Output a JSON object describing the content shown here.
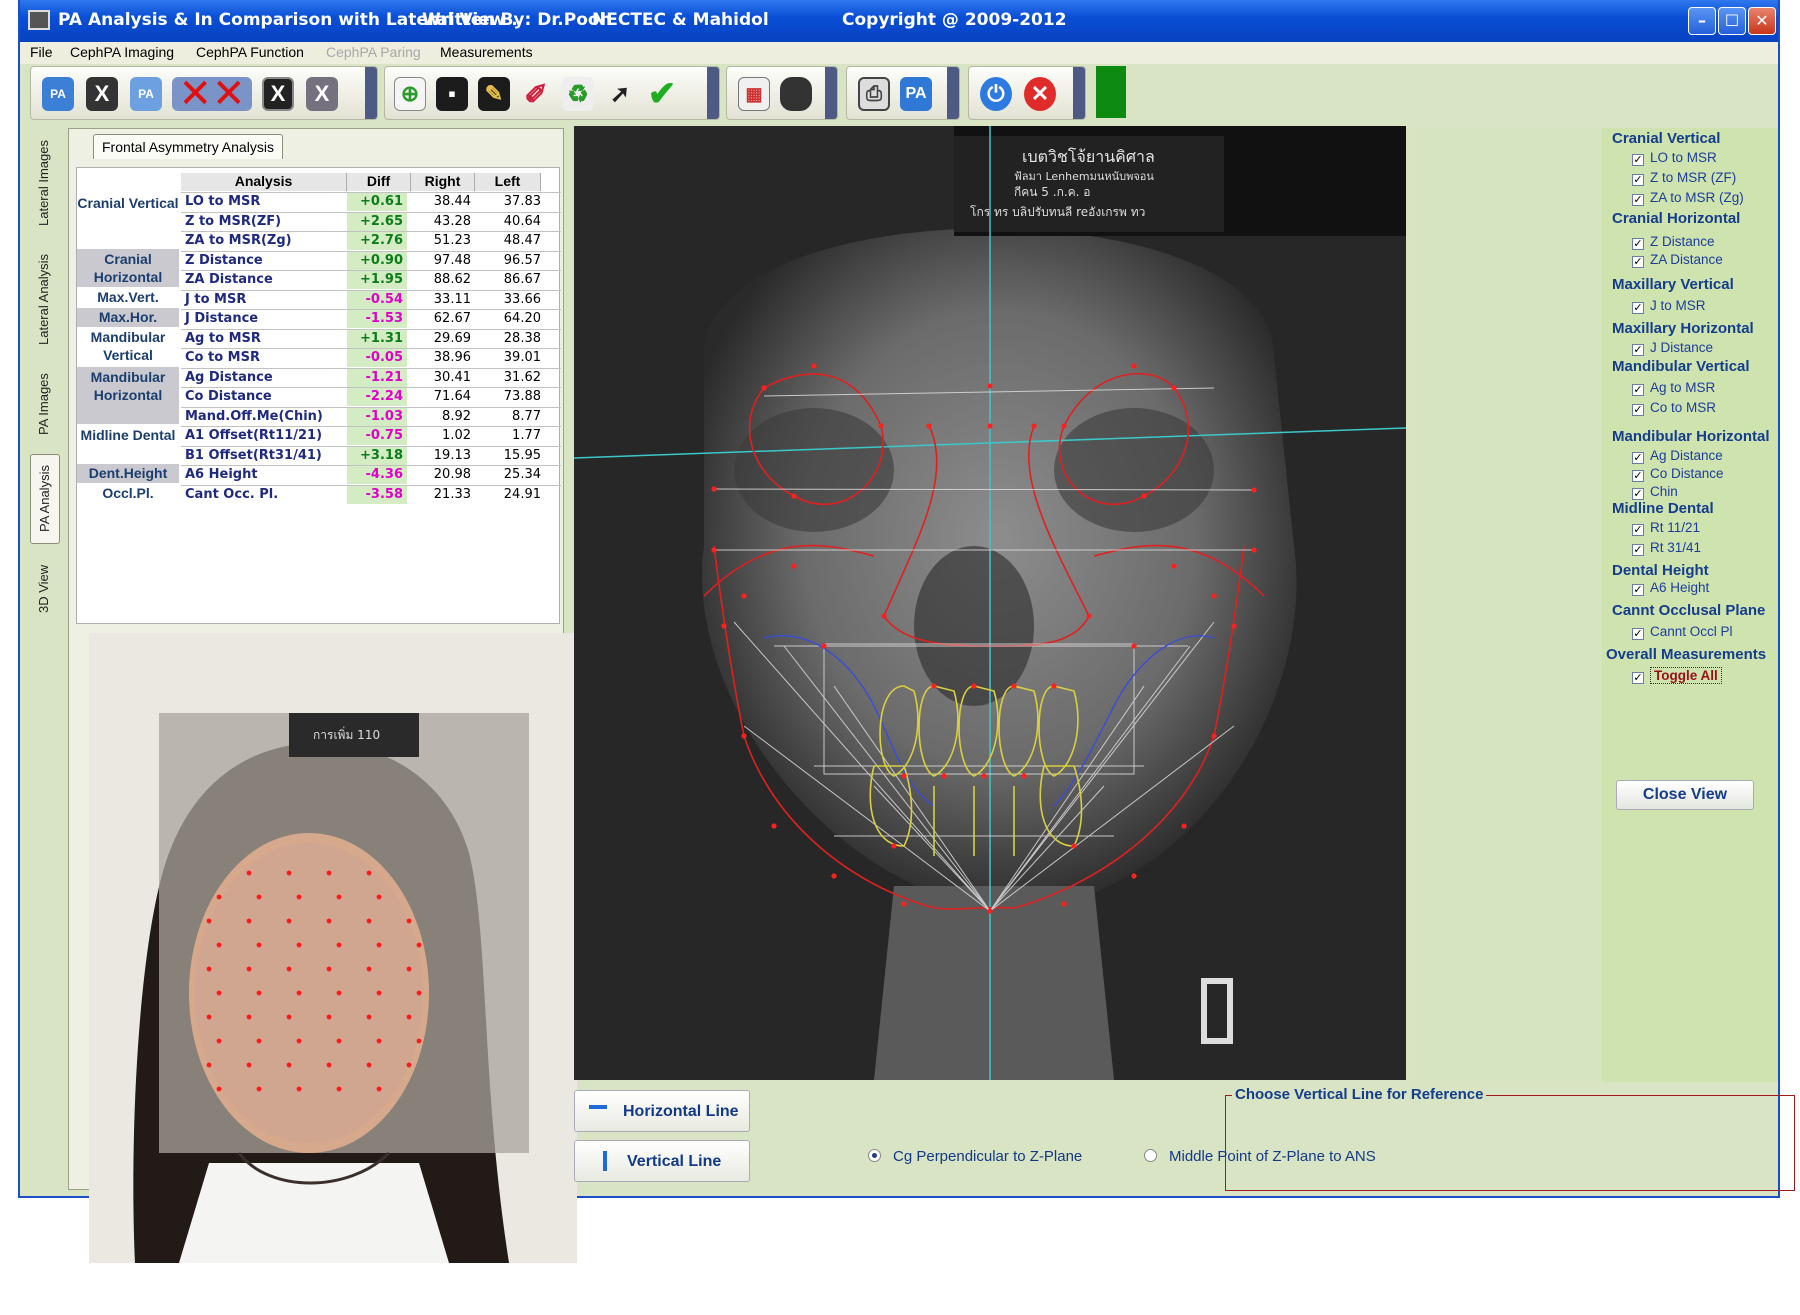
{
  "window": {
    "title": "PA Analysis & In Comparison with Lateral View .",
    "author": "Written By: Dr.Pooh",
    "org": "NECTEC & Mahidol",
    "copyright": "Copyright @ 2009-2012",
    "buttons": {
      "minimize": "–",
      "maximize": "☐",
      "close": "✕"
    }
  },
  "menu": {
    "file": "File",
    "imaging": "CephPA Imaging",
    "function": "CephPA Function",
    "paring": "CephPA Paring",
    "measurements": "Measurements"
  },
  "toolbar": {
    "pa1": "PA",
    "xray": "X",
    "pa2": "PA",
    "x_dark": "X",
    "x_grey": "X",
    "pa_monitor": "PA"
  },
  "side_tabs": [
    "Lateral Images",
    "Lateral Analysis",
    "PA Images",
    "PA Analysis",
    "3D View"
  ],
  "analysis": {
    "tab_label": "Frontal Asymmetry Analysis",
    "headers": {
      "analysis": "Analysis",
      "diff": "Diff",
      "right": "Right",
      "left": "Left"
    },
    "categories": [
      "Cranial Vertical",
      "Cranial Horizontal",
      "Max.Vert.",
      "Max.Hor.",
      "Mandibular Vertical",
      "Mandibular Horizontal",
      "Midline Dental",
      "Dent.Height",
      "Occl.Pl."
    ],
    "rows": [
      {
        "name": "LO to MSR",
        "diff": "+0.61",
        "right": "38.44",
        "left": "37.83"
      },
      {
        "name": "Z to MSR(ZF)",
        "diff": "+2.65",
        "right": "43.28",
        "left": "40.64"
      },
      {
        "name": "ZA to MSR(Zg)",
        "diff": "+2.76",
        "right": "51.23",
        "left": "48.47"
      },
      {
        "name": "Z Distance",
        "diff": "+0.90",
        "right": "97.48",
        "left": "96.57"
      },
      {
        "name": "ZA Distance",
        "diff": "+1.95",
        "right": "88.62",
        "left": "86.67"
      },
      {
        "name": "J to MSR",
        "diff": "-0.54",
        "right": "33.11",
        "left": "33.66"
      },
      {
        "name": "J Distance",
        "diff": "-1.53",
        "right": "62.67",
        "left": "64.20"
      },
      {
        "name": "Ag to MSR",
        "diff": "+1.31",
        "right": "29.69",
        "left": "28.38"
      },
      {
        "name": "Co to MSR",
        "diff": "-0.05",
        "right": "38.96",
        "left": "39.01"
      },
      {
        "name": "Ag Distance",
        "diff": "-1.21",
        "right": "30.41",
        "left": "31.62"
      },
      {
        "name": "Co Distance",
        "diff": "-2.24",
        "right": "71.64",
        "left": "73.88"
      },
      {
        "name": "Mand.Off.Me(Chin)",
        "diff": "-1.03",
        "right": "8.92",
        "left": "8.77"
      },
      {
        "name": "A1 Offset(Rt11/21)",
        "diff": "-0.75",
        "right": "1.02",
        "left": "1.77"
      },
      {
        "name": "B1 Offset(Rt31/41)",
        "diff": "+3.18",
        "right": "19.13",
        "left": "15.95"
      },
      {
        "name": "A6 Height",
        "diff": "-4.36",
        "right": "20.98",
        "left": "25.34"
      },
      {
        "name": "Cant Occ. Pl.",
        "diff": "-3.58",
        "right": "21.33",
        "left": "24.91"
      }
    ]
  },
  "xray_label": {
    "line1": "เบตวิชโจ้ยานคิศาล",
    "line2": "ฟ้ลมา Lenhemมนหนับพจอน",
    "line3": "กีคน 5 .ก.ค. อ",
    "line4": "โกร ทร บลิปรับทนลี reอังเกรพ ทว"
  },
  "photo_label": "การเพิ่ม 110",
  "measurements": {
    "groups": [
      {
        "title": "Cranial Vertical",
        "items": [
          "LO to MSR",
          "Z to MSR (ZF)",
          "ZA to MSR (Zg)"
        ]
      },
      {
        "title": "Cranial Horizontal",
        "items": [
          "Z Distance",
          "ZA Distance"
        ]
      },
      {
        "title": "Maxillary Vertical",
        "items": [
          "J to MSR"
        ]
      },
      {
        "title": "Maxillary Horizontal",
        "items": [
          "J Distance"
        ]
      },
      {
        "title": "Mandibular Vertical",
        "items": [
          "Ag to MSR",
          "Co to MSR"
        ]
      },
      {
        "title": "Mandibular Horizontal",
        "items": [
          "Ag Distance",
          "Co Distance",
          "Chin"
        ]
      },
      {
        "title": "Midline Dental",
        "items": [
          "Rt 11/21",
          "Rt 31/41"
        ]
      },
      {
        "title": "Dental Height",
        "items": [
          "A6 Height"
        ]
      },
      {
        "title": "Cannt Occlusal Plane",
        "items": [
          "Cannt Occl Pl"
        ]
      },
      {
        "title": "Overall Measurements",
        "items": [
          "Toggle All"
        ]
      }
    ],
    "check_mark": "✓",
    "close_label": "Close View"
  },
  "bottom": {
    "hline_label": "Horizontal Line",
    "vline_label": "Vertical Line",
    "ref_title": "Choose Vertical Line for Reference",
    "radio1": "Cg Perpendicular to Z-Plane",
    "radio2": "Middle Point of Z-Plane to ANS",
    "selected": "Cg Perpendicular to Z-Plane"
  },
  "colors": {
    "title_bar": "#0a4fd6",
    "panel": "#d8e4c4",
    "diff_bg": "#d3ecc4",
    "positive": "#0b7d18",
    "negative": "#e000c8",
    "tracing": "#e02020",
    "midline": "#3cc8c8",
    "teeth": "#d8d040"
  }
}
